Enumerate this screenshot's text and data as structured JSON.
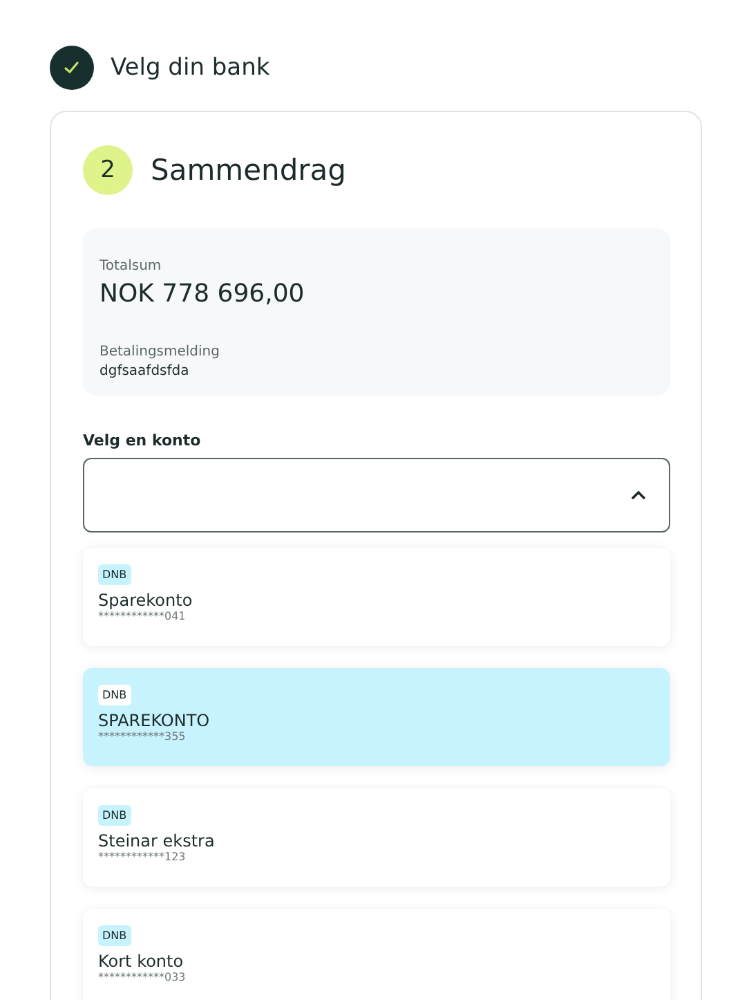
{
  "step1": {
    "label": "Velg din bank",
    "done": true
  },
  "step2": {
    "number": "2",
    "title": "Sammendrag"
  },
  "summary": {
    "total_label": "Totalsum",
    "total": "NOK 778 696,00",
    "message_label": "Betalingsmelding",
    "message": "dgfsaafdsfda"
  },
  "account_select": {
    "label": "Velg en konto",
    "expanded": true
  },
  "accounts": [
    {
      "bank": "DNB",
      "name": "Sparekonto",
      "number": "************041",
      "selected": false
    },
    {
      "bank": "DNB",
      "name": "SPAREKONTO",
      "number": "************355",
      "selected": true
    },
    {
      "bank": "DNB",
      "name": "Steinar ekstra",
      "number": "************123",
      "selected": false
    },
    {
      "bank": "DNB",
      "name": "Kort konto",
      "number": "************033",
      "selected": false
    }
  ]
}
